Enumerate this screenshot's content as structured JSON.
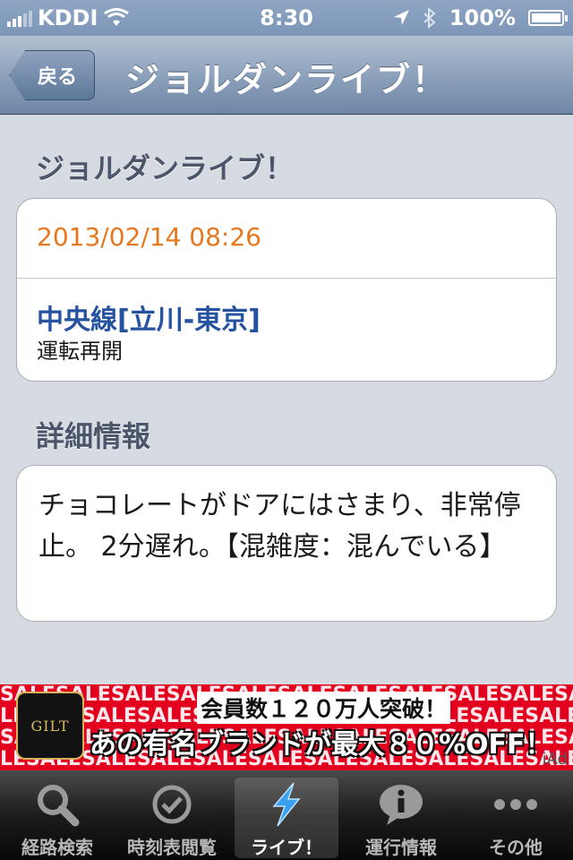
{
  "status_bar": {
    "carrier": "KDDI",
    "time": "8:30",
    "battery": "100%"
  },
  "nav": {
    "back_label": "戻る",
    "title": "ジョルダンライブ！"
  },
  "main": {
    "section_title": "ジョルダンライブ！",
    "report": {
      "datetime": "2013/02/14 08:26",
      "line": "中央線[立川-東京]",
      "status": "運転再開"
    },
    "detail_title": "詳細情報",
    "detail_text": "チョコレートがドアにはさまり、非常停止。 2分遅れ。【混雑度：混んでいる】"
  },
  "ad": {
    "brand": "GILT",
    "pattern_text": "SALE",
    "line1": "会員数１２０万人突破！",
    "line2": "あの有名ブランドが最大８０%OFF！",
    "network": "iAd"
  },
  "tabs": [
    {
      "label": "経路検索",
      "icon": "magnifier-icon"
    },
    {
      "label": "時刻表閲覧",
      "icon": "clock-check-icon"
    },
    {
      "label": "ライブ！",
      "icon": "lightning-icon",
      "active": true
    },
    {
      "label": "運行情報",
      "icon": "info-bubble-icon"
    },
    {
      "label": "その他",
      "icon": "more-dots-icon"
    }
  ],
  "colors": {
    "accent_date": "#e7771d",
    "line_link": "#2653a0",
    "ad_background": "#e3001f"
  }
}
